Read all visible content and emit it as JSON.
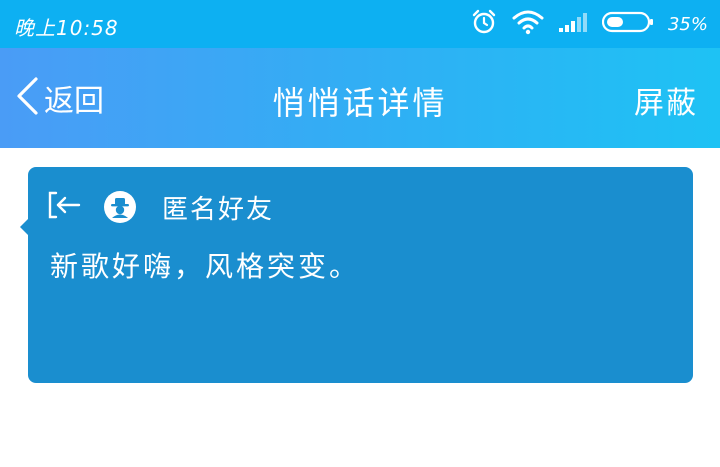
{
  "status_bar": {
    "time": "晚上10:58",
    "battery_percent": "35%",
    "icons": [
      "alarm-icon",
      "wifi-icon",
      "signal-icon",
      "battery-icon"
    ]
  },
  "nav": {
    "back_label": "返回",
    "title": "悄悄话详情",
    "block_label": "屏蔽"
  },
  "message": {
    "sender": "匿名好友",
    "text": "新歌好嗨，风格突变。"
  },
  "colors": {
    "status_bar_bg": "#0db0f2",
    "nav_gradient_start": "#4a9cf6",
    "nav_gradient_end": "#1ec2f4",
    "card_bg": "#1a8ecf"
  }
}
